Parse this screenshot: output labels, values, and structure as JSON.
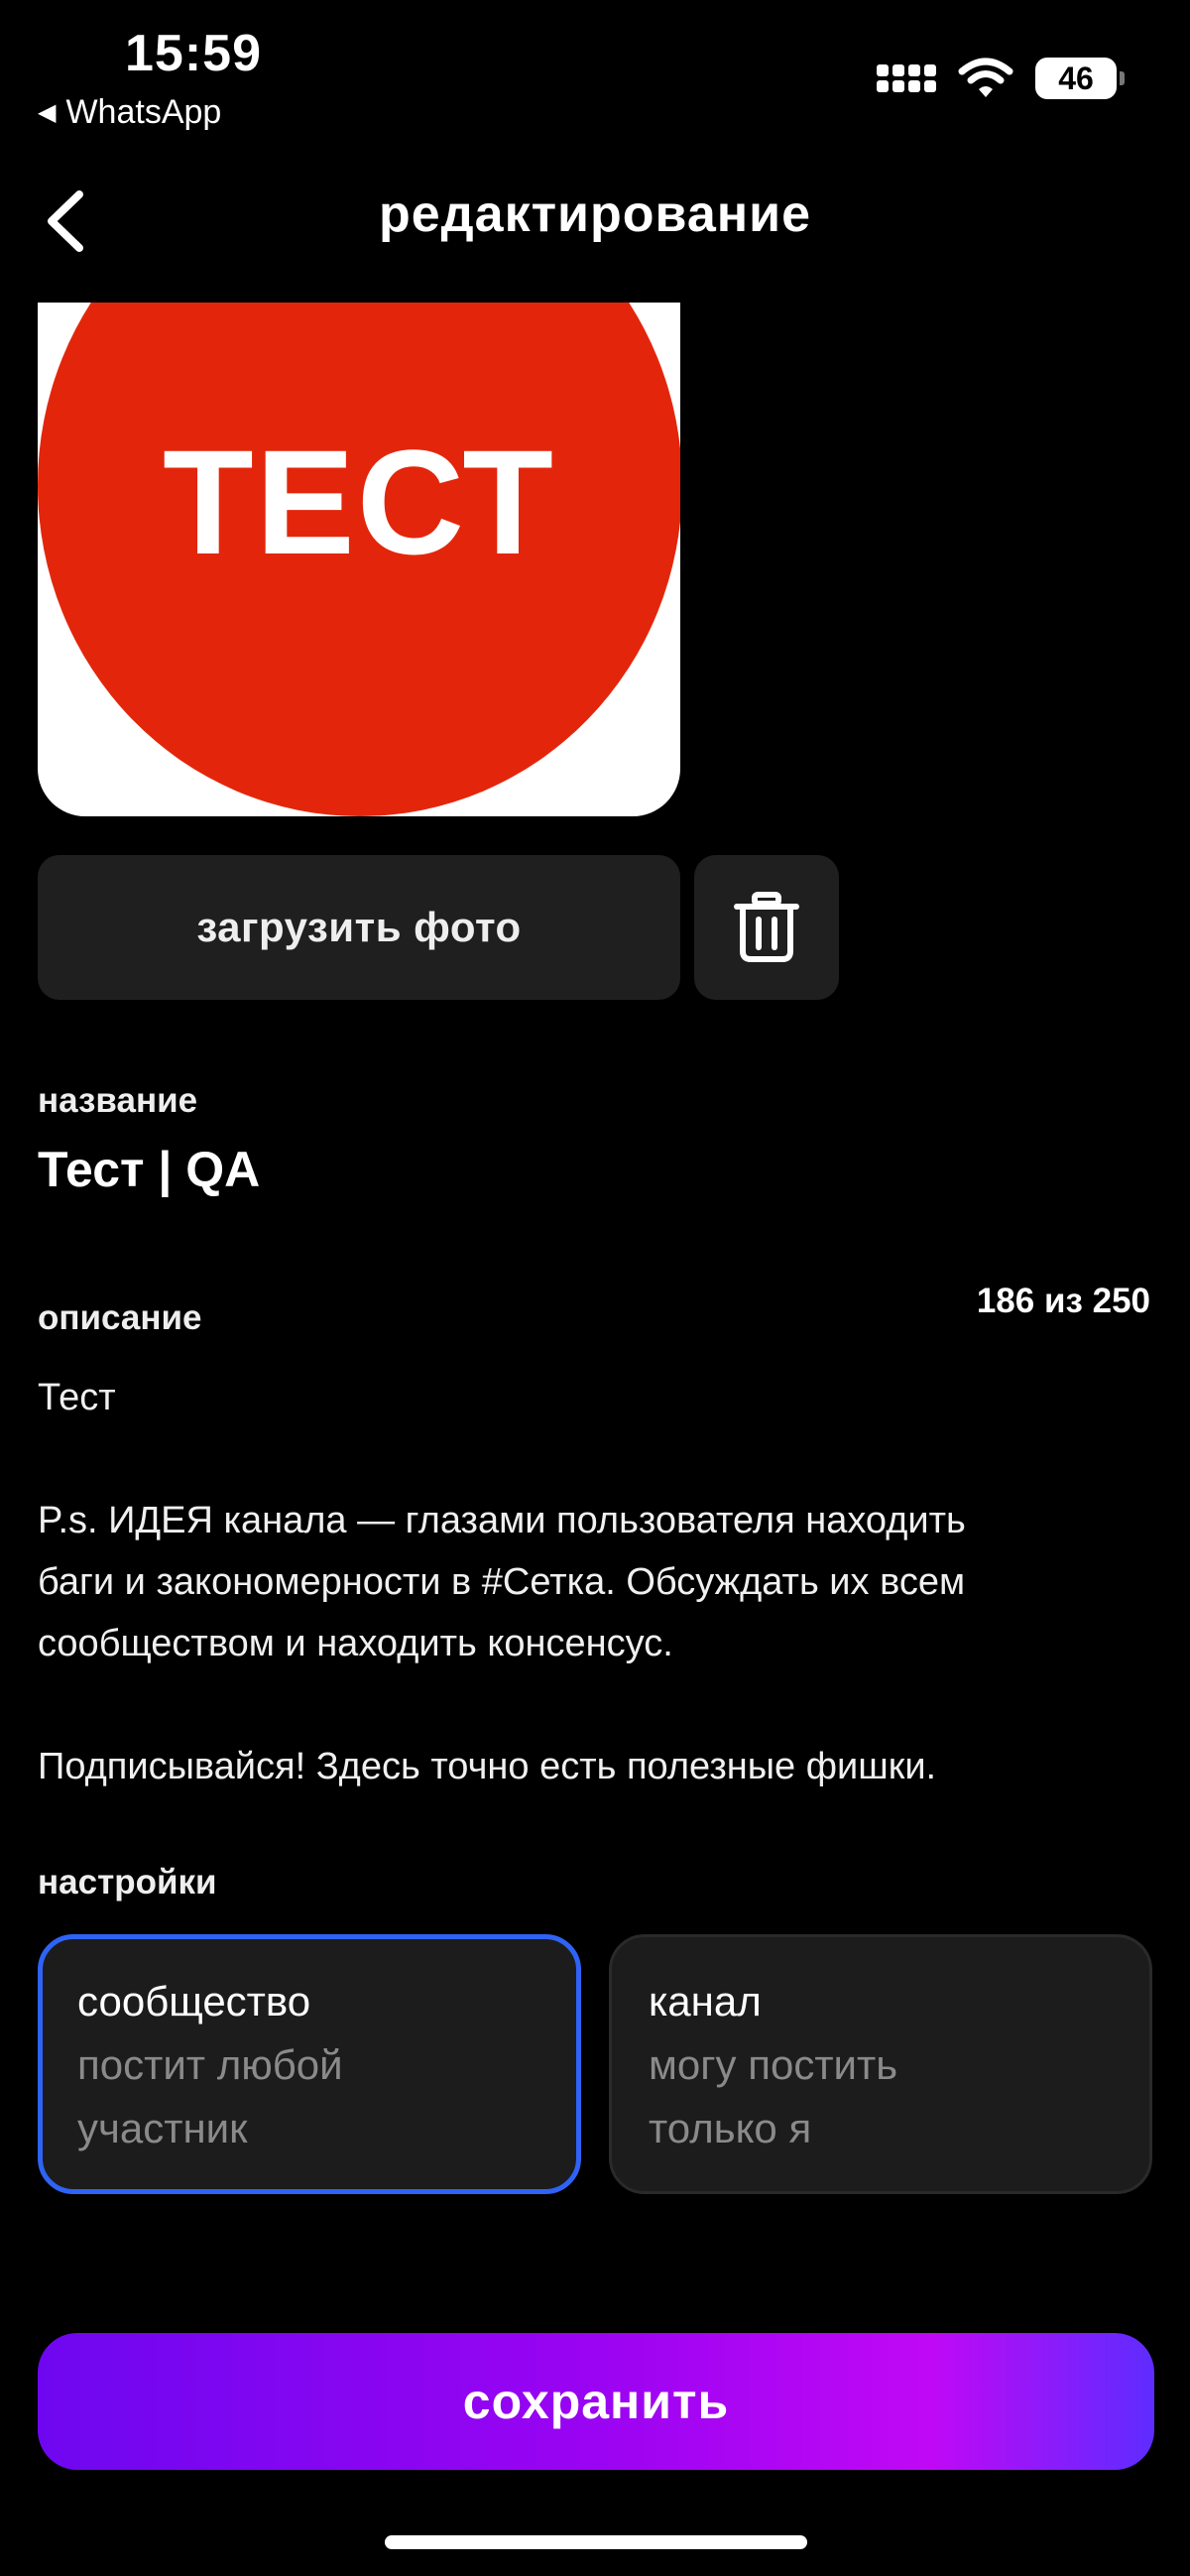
{
  "status_bar": {
    "time": "15:59",
    "back_app": "WhatsApp",
    "battery": "46"
  },
  "header": {
    "title": "редактирование"
  },
  "photo": {
    "stamp_text": "ТЕСТ"
  },
  "buttons": {
    "upload": "загрузить фото",
    "save": "сохранить"
  },
  "name": {
    "label": "название",
    "value": "Тест | QA"
  },
  "description": {
    "label": "описание",
    "counter": "186 из 250",
    "text": "Тест\n\nP.s. ИДЕЯ канала — глазами пользователя находить\nбаги и закономерности в #Сетка. Обсуждать их всем\nсообществом и находить консенсус.\n\nПодписывайся! Здесь точно есть полезные фишки."
  },
  "settings": {
    "label": "настройки",
    "options": [
      {
        "title": "сообщество",
        "line1": "постит любой",
        "line2": "участник",
        "selected": true
      },
      {
        "title": "канал",
        "line1": "могу постить",
        "line2": "только я",
        "selected": false
      }
    ]
  },
  "colors": {
    "accent_border": "#2f63f6",
    "stamp_red": "#e3260b",
    "save_gradient_start": "#6e07f0",
    "save_gradient_end": "#c008f5"
  },
  "icons": {
    "nav_back": "chevron-left-icon",
    "trash": "trash-icon",
    "wifi": "wifi-icon",
    "signal": "cellular-signal-icon",
    "battery": "battery-icon"
  }
}
